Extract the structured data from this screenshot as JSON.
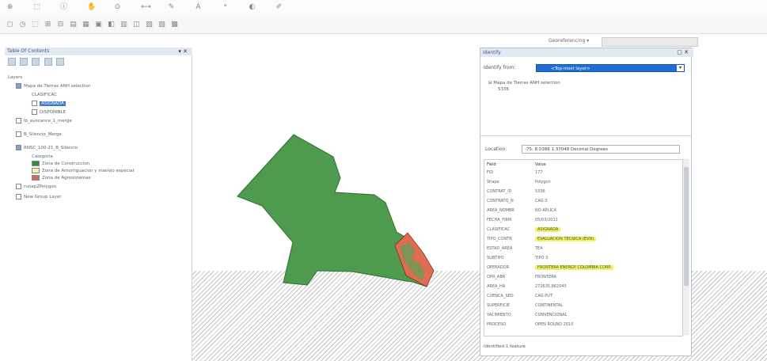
{
  "toolbar": {
    "icons": [
      "add-data-icon",
      "select-icon",
      "identify-icon",
      "pan-icon",
      "zoom-icon",
      "measure-icon",
      "drawing-icon",
      "text-icon",
      "font-icon",
      "color-icon",
      "editor-icon"
    ],
    "georef_label": "Georeferencing ▾"
  },
  "toc": {
    "title": "Table Of Contents",
    "layers_label": "Layers",
    "items": [
      {
        "label": "Mapa de Tierras ANH selection",
        "checked": true
      },
      {
        "label": "CLASIFICAC",
        "checked": false
      },
      {
        "label": "ASIGNADA",
        "checked": false,
        "selected": true
      },
      {
        "label": "DISPONIBLE",
        "checked": false
      },
      {
        "label": "lb_avocance_1_merge",
        "checked": false
      },
      {
        "label": "B_Silencio_Merge",
        "checked": false
      },
      {
        "label": "RNSC_100-21_B_Silencio",
        "checked": true
      },
      {
        "label": "Categoria",
        "checked": false
      }
    ],
    "legend": [
      {
        "label": "Zona de Construccion",
        "color": "#3a8a3a"
      },
      {
        "label": "Zona de Amortiguacion y manejo especial",
        "color": "#f3efb5"
      },
      {
        "label": "Zona de Agrosistemas",
        "color": "#d86a5a"
      }
    ],
    "more": [
      {
        "label": "runap2Polygon"
      },
      {
        "label": "New Group Layer"
      }
    ]
  },
  "identify": {
    "title": "Identify",
    "from_label": "Identify from:",
    "from_value": "<Top-most layer>",
    "tree_root": "Mapa de Tierras ANH selection",
    "tree_child": "5336",
    "location_label": "Location:",
    "location_value": "-75, 8.0386  1.37048 Decimal Degrees",
    "table_headers": {
      "field": "Field",
      "value": "Value"
    },
    "rows": [
      {
        "field": "FID",
        "value": "177",
        "hl": false
      },
      {
        "field": "Shape",
        "value": "Polygon",
        "hl": false
      },
      {
        "field": "CONTRAT_ID",
        "value": "5336",
        "hl": false
      },
      {
        "field": "CONTRATO_N",
        "value": "CAG 3",
        "hl": false
      },
      {
        "field": "AREA_NOMBR",
        "value": "NO APLICA",
        "hl": false
      },
      {
        "field": "FECHA_FIRM",
        "value": "05/03/2011",
        "hl": false
      },
      {
        "field": "CLASIFICAC",
        "value": "ASIGNADA",
        "hl": true
      },
      {
        "field": "TIPO_CONTR",
        "value": "EVALUACION TECNICA (EVN)",
        "hl": true
      },
      {
        "field": "ESTAD_AREA",
        "value": "TEA",
        "hl": false
      },
      {
        "field": "SUBTIPO",
        "value": "TIPO 3",
        "hl": false
      },
      {
        "field": "OPERADOR",
        "value": "FRONTERA ENERGY COLOMBIA CORP.",
        "hl": true
      },
      {
        "field": "OPR_ABR",
        "value": "FRONTERA",
        "hl": false
      },
      {
        "field": "AREA_HA",
        "value": "272635,862045",
        "hl": false
      },
      {
        "field": "CUENCA_SED",
        "value": "CAG PUT",
        "hl": false
      },
      {
        "field": "SUPERFICIE",
        "value": "CONTINENTAL",
        "hl": false
      },
      {
        "field": "YACIMIENTO",
        "value": "CONVENCIONAL",
        "hl": false
      },
      {
        "field": "PROCESO",
        "value": "OPEN ROUND 2010",
        "hl": false
      }
    ],
    "status": "Identified 1 feature"
  }
}
